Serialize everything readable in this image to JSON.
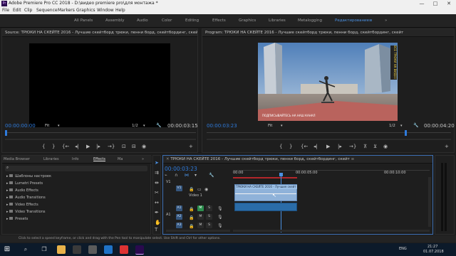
{
  "titlebar": {
    "app_icon": "Pr",
    "title": "Adobe Premiere Pro CC 2018 - D:\\видео premiere pro\\для монтажа *",
    "minimize": "—",
    "maximize": "□",
    "close": "✕"
  },
  "menu": [
    "File",
    "Edit",
    "Clip",
    "Sequence",
    "Markers",
    "Graphics",
    "Window",
    "Help"
  ],
  "workspaces": {
    "items": [
      "All Panels",
      "Assembly",
      "Audio",
      "Color",
      "Editing",
      "Effects",
      "Graphics",
      "Libraries",
      "Metalogging",
      "Редактирование"
    ],
    "active": "Редактирование",
    "more": "»",
    "menu_icon": "≡"
  },
  "source": {
    "title": "Source: ТРЮКИ НА СКЕЙТЕ 2016 - Лучшие скейтборд трюки, пенни борд, скейтбординг, скейт.mp4",
    "timecode": "00:00:00:00",
    "fit": "Fit",
    "ratio": "1/2",
    "duration": "00:00:03:15"
  },
  "program": {
    "title": "Program: ТРЮКИ НА СКЕЙТЕ 2016 - Лучшие скейтборд трюки, пенни борд, скейтбординг, скейт",
    "timecode": "00:00:03:23",
    "fit": "Fit",
    "ratio": "1/2",
    "duration": "00:00:04:20",
    "watermark": "ВСЕ ТРЮКИ НА ВИДЕО",
    "bottom_label": "ПОДПИСЫВАЙТЕСЬ НА НАШ КАНАЛ"
  },
  "project": {
    "tabs": [
      "Media Browser",
      "Libraries",
      "Info",
      "Effects",
      "Ma"
    ],
    "active_tab": "Effects",
    "more": "»",
    "items": [
      "Шаблоны настроек",
      "Lumetri Presets",
      "Audio Effects",
      "Audio Transitions",
      "Video Effects",
      "Video Transitions",
      "Presets"
    ]
  },
  "timeline": {
    "title": "ТРЮКИ НА СКЕЙТЕ 2016 - Лучшие скейтборд трюки, пенни борд, скейтбординг, скейт",
    "timecode": "00:00:03:23",
    "ruler": [
      "00:00",
      "00:00:05:00",
      "00:00:10:00"
    ],
    "tracks": {
      "v1": "V1",
      "v1_target": "V1",
      "video_name": "Video 1",
      "a1": "A1",
      "a1_target": "A1",
      "a2": "A2",
      "a3": "A3",
      "mute": "M",
      "solo": "S",
      "lock": "🔒"
    },
    "clip_label": "ТРЮКИ НА СКЕЙТЕ 2016 - Лучшие скейт"
  },
  "statusbar": {
    "text": "Click to select a speed keyframe, or click and drag with the Pen tool to manipulate select. Use Shift and Ctrl for other options."
  },
  "taskbar": {
    "lang": "ENG",
    "time": "21:27",
    "date": "01.07.2018"
  }
}
